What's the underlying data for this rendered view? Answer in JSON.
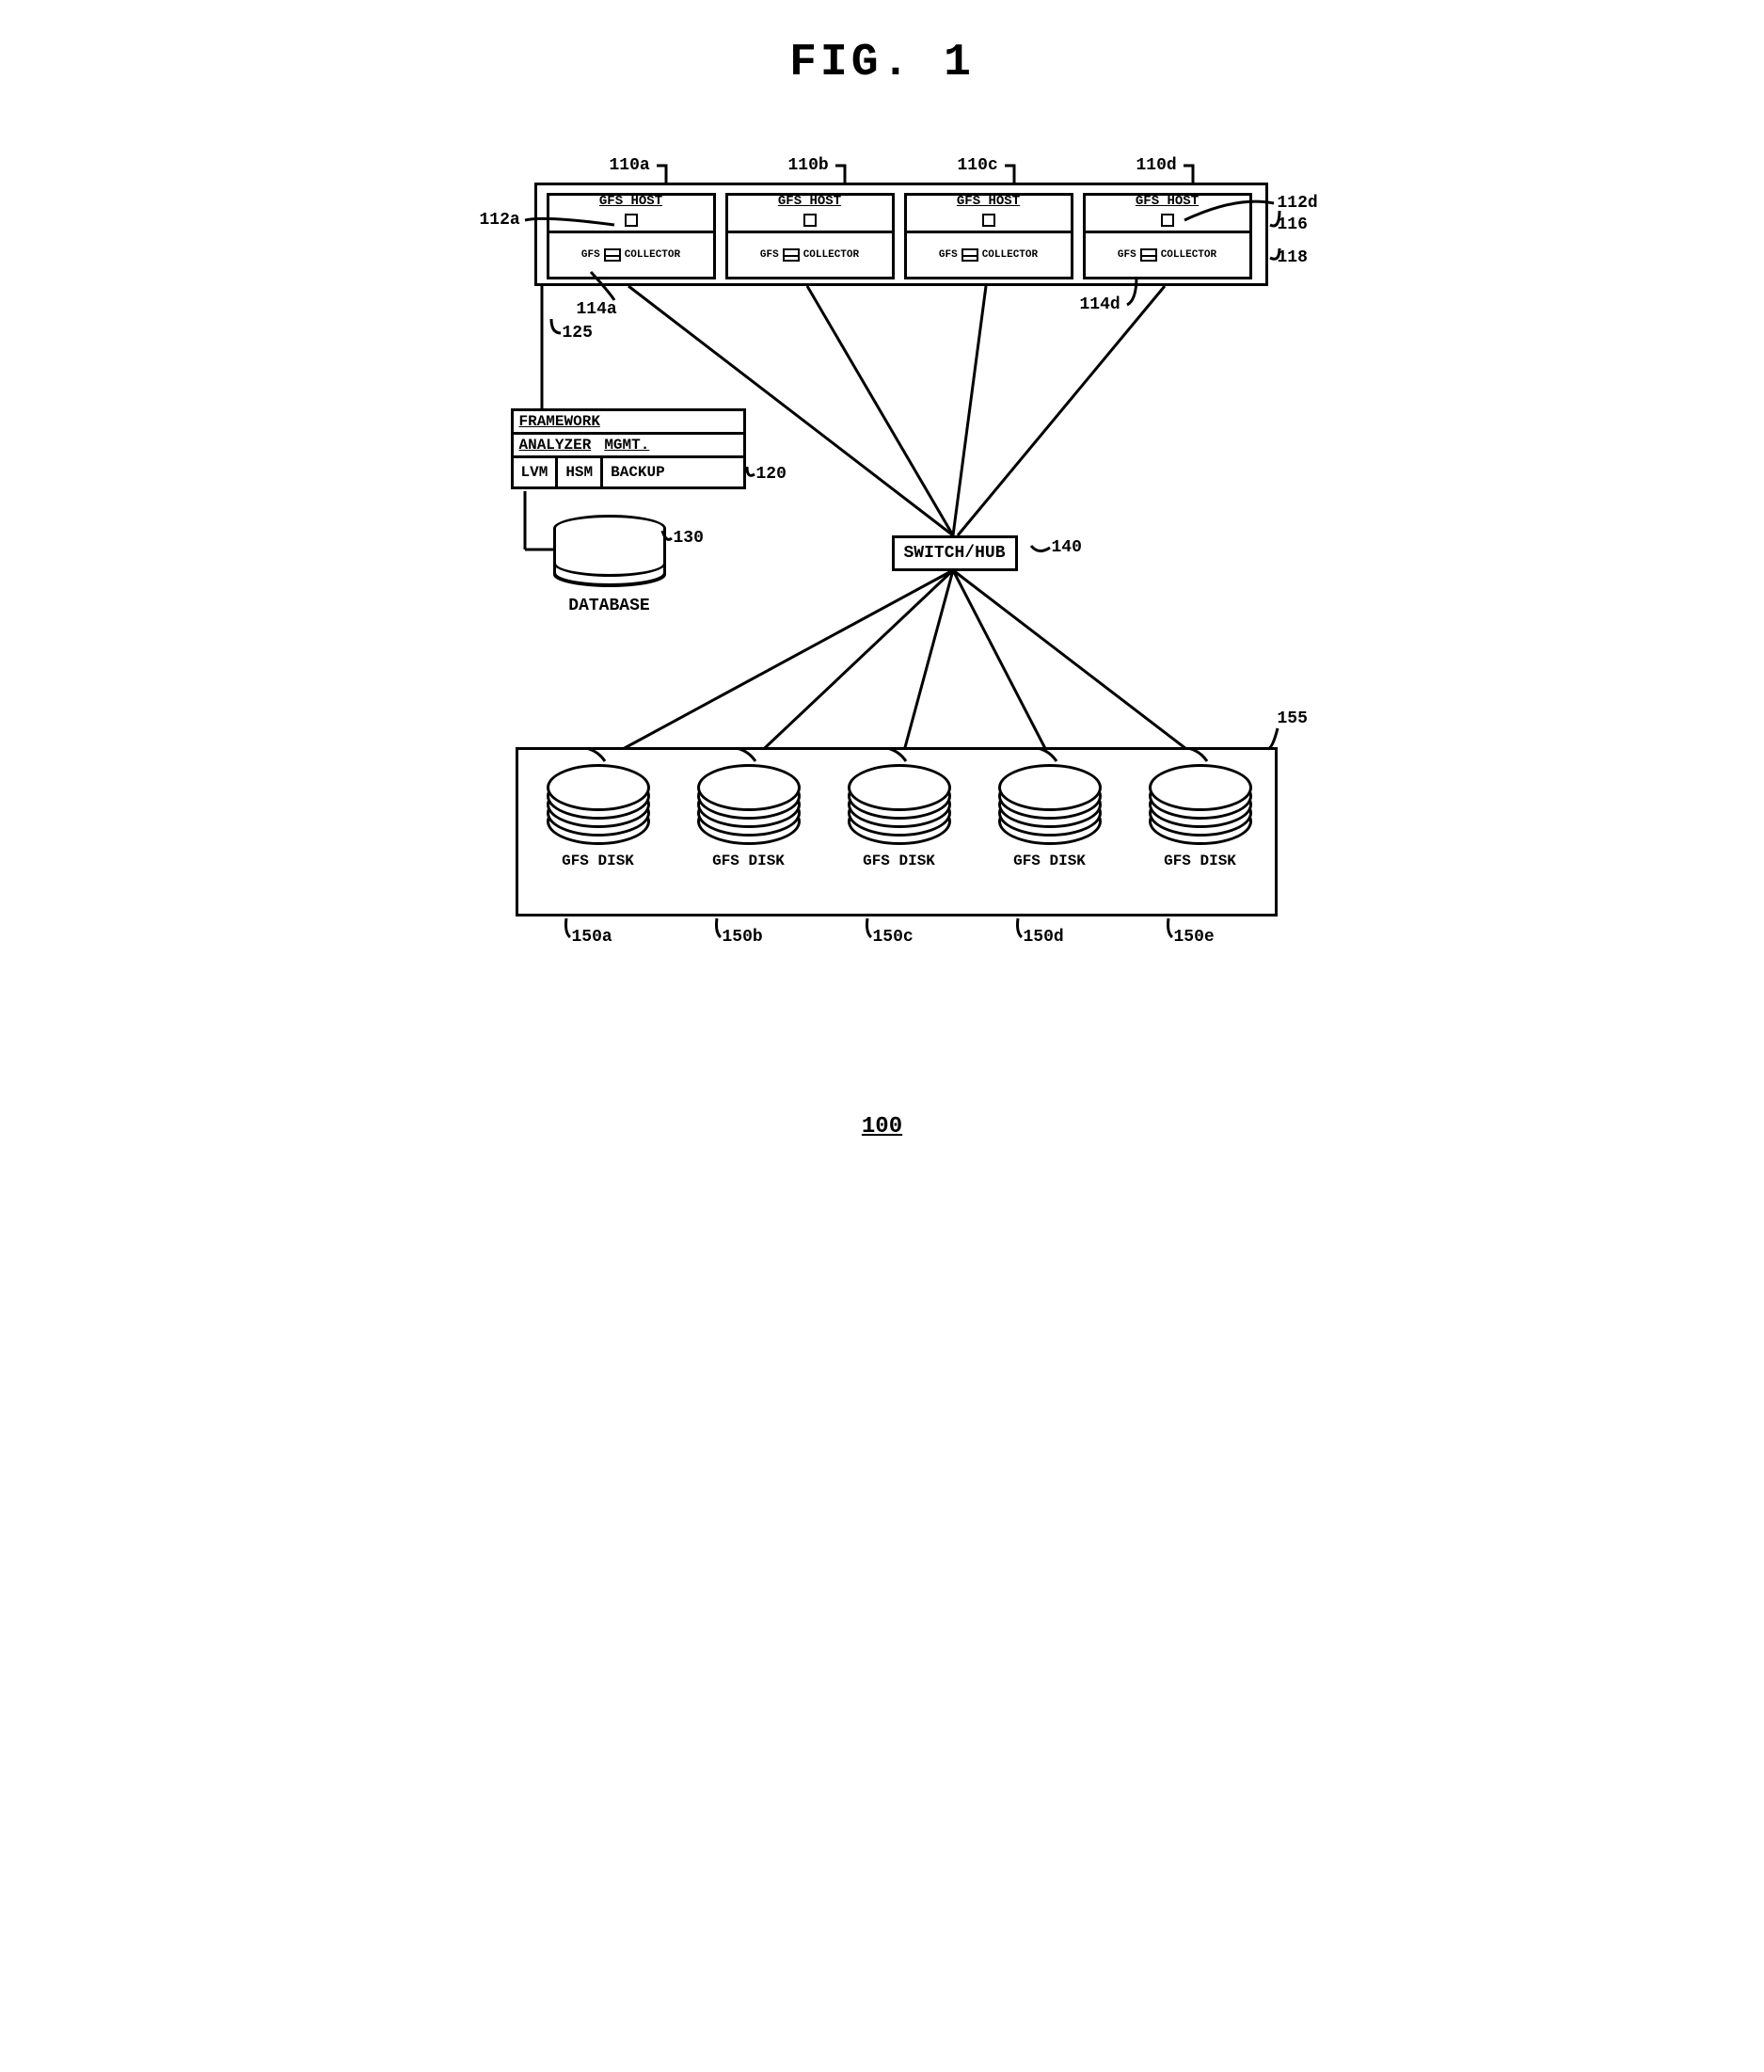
{
  "figure_title": "FIG. 1",
  "figure_number": "100",
  "hosts": {
    "outer_ref_left": "116",
    "outer_ref_left2": "118",
    "top_refs": [
      "110a",
      "110b",
      "110c",
      "110d"
    ],
    "host_label": "GFS HOST",
    "collector_left": "GFS",
    "collector_right": "COLLECTOR",
    "ref_112a": "112a",
    "ref_112d": "112d",
    "ref_114a": "114a",
    "ref_114d": "114d",
    "ref_125": "125"
  },
  "framework": {
    "row1": "FRAMEWORK",
    "row2a": "ANALYZER",
    "row2b": "MGMT.",
    "row3": [
      "LVM",
      "HSM",
      "BACKUP"
    ],
    "ref": "120"
  },
  "database": {
    "label": "DATABASE",
    "ref": "130"
  },
  "switch": {
    "label": "SWITCH/HUB",
    "ref": "140"
  },
  "disks": {
    "outer_ref": "155",
    "label": "GFS DISK",
    "refs": [
      "150a",
      "150b",
      "150c",
      "150d",
      "150e"
    ]
  }
}
